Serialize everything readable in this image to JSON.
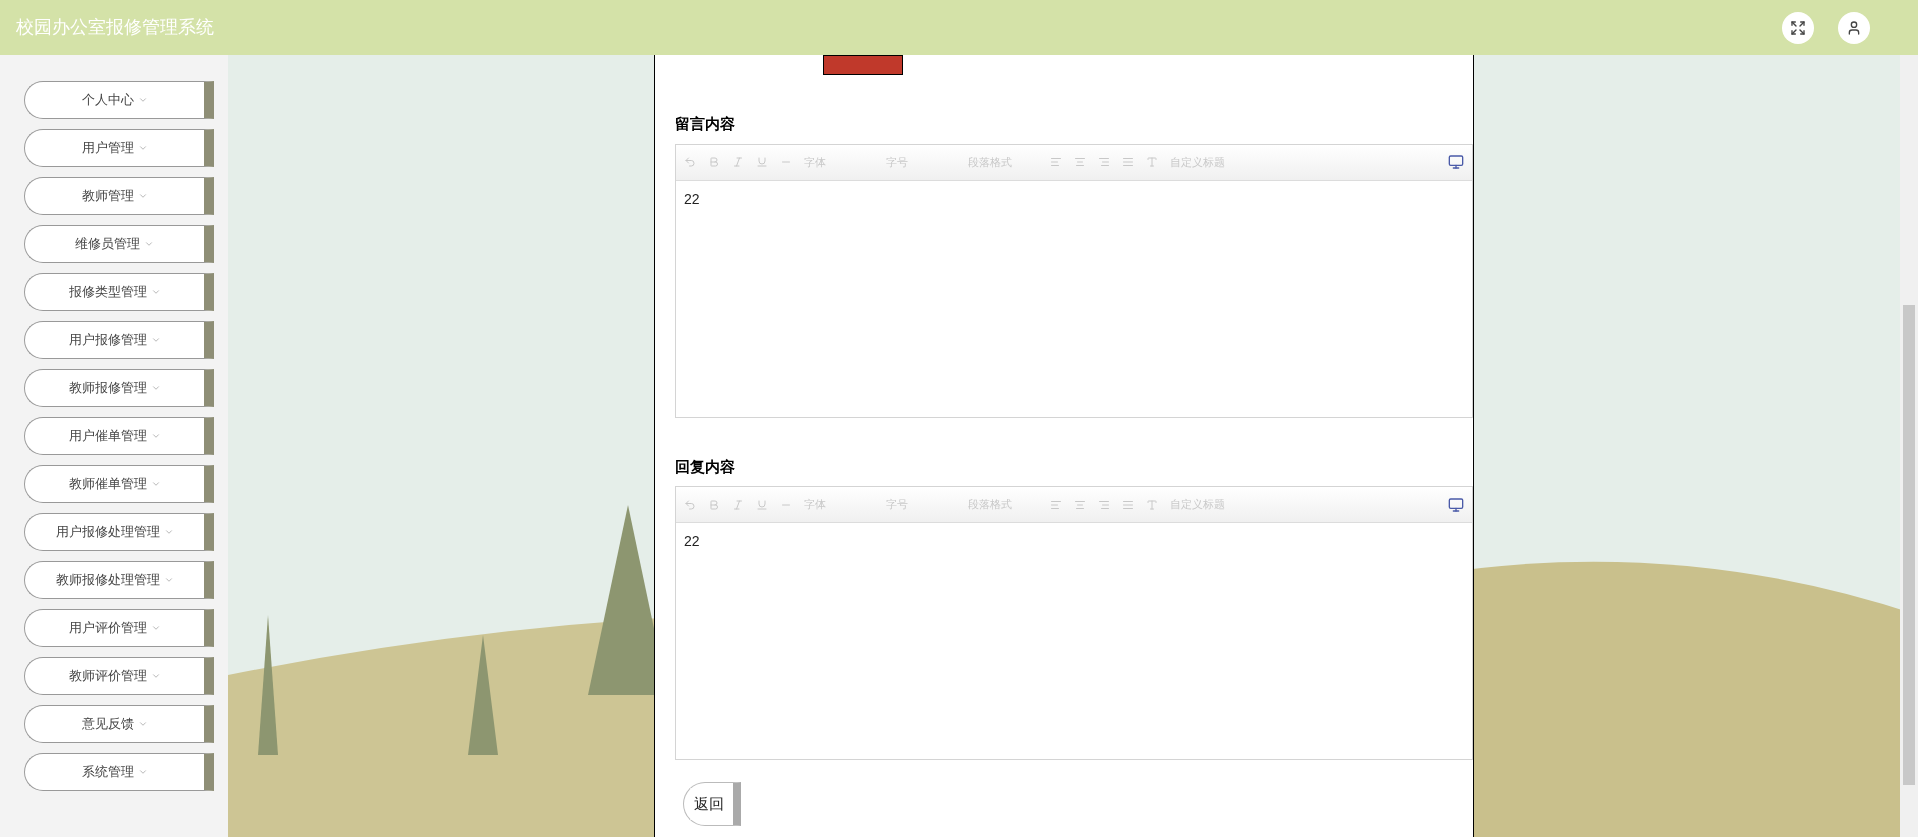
{
  "header": {
    "title": "校园办公室报修管理系统"
  },
  "sidebar": {
    "items": [
      {
        "label": "个人中心"
      },
      {
        "label": "用户管理"
      },
      {
        "label": "教师管理"
      },
      {
        "label": "维修员管理"
      },
      {
        "label": "报修类型管理"
      },
      {
        "label": "用户报修管理"
      },
      {
        "label": "教师报修管理"
      },
      {
        "label": "用户催单管理"
      },
      {
        "label": "教师催单管理"
      },
      {
        "label": "用户报修处理管理"
      },
      {
        "label": "教师报修处理管理"
      },
      {
        "label": "用户评价管理"
      },
      {
        "label": "教师评价管理"
      },
      {
        "label": "意见反馈"
      },
      {
        "label": "系统管理"
      }
    ]
  },
  "form": {
    "editors": [
      {
        "label": "留言内容",
        "value": "22",
        "toolbar": [
          "字体",
          "字号",
          "段落格式",
          "自定义标题"
        ]
      },
      {
        "label": "回复内容",
        "value": "22",
        "toolbar": [
          "字体",
          "字号",
          "段落格式",
          "自定义标题"
        ]
      }
    ],
    "back_button": "返回"
  }
}
